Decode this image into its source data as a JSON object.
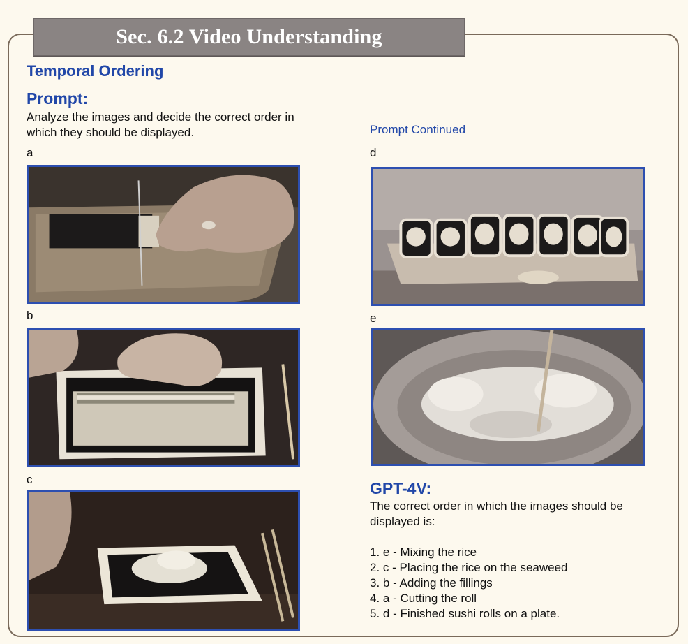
{
  "section_title": "Sec. 6.2 Video Understanding",
  "task_title": "Temporal Ordering",
  "prompt": {
    "heading": "Prompt:",
    "text_line1": "Analyze the images and decide the correct order in",
    "text_line2": "which they should be displayed.",
    "continued": "Prompt Continued"
  },
  "images": {
    "a": {
      "label": "a"
    },
    "b": {
      "label": "b"
    },
    "c": {
      "label": "c"
    },
    "d": {
      "label": "d"
    },
    "e": {
      "label": "e"
    }
  },
  "response": {
    "heading": "GPT-4V:",
    "intro_line1": "The correct order in which the images should be",
    "intro_line2": "displayed is:",
    "items": [
      "1. e - Mixing the rice",
      "2. c - Placing the rice on the seaweed",
      "3. b - Adding the fillings",
      "4. a - Cutting the roll",
      "5. d - Finished sushi rolls on a plate."
    ]
  },
  "colors": {
    "heading_blue": "#2147a8",
    "frame_blue": "#2d4fb0",
    "title_bar": "#8a8483",
    "background": "#fdf9ee"
  }
}
